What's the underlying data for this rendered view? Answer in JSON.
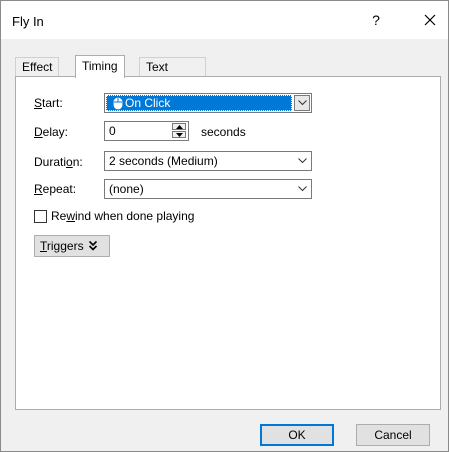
{
  "window": {
    "title": "Fly In",
    "help_label": "?",
    "close_label": "✕"
  },
  "tabs": [
    {
      "label": "Effect",
      "active": false
    },
    {
      "label": "Timing",
      "active": true
    },
    {
      "label": "Text Animation",
      "active": false
    }
  ],
  "timing": {
    "start": {
      "label_u": "S",
      "label_rest": "tart:",
      "value": "On Click",
      "icon": "mouse-icon"
    },
    "delay": {
      "label_u": "D",
      "label_rest": "elay:",
      "value": "0",
      "unit": "seconds"
    },
    "duration": {
      "label_pre": "Durati",
      "label_u": "o",
      "label_rest": "n:",
      "value": "2 seconds (Medium)"
    },
    "repeat": {
      "label_u": "R",
      "label_rest": "epeat:",
      "value": "(none)"
    },
    "rewind": {
      "label_pre": "Re",
      "label_u": "w",
      "label_rest": "ind when done playing",
      "checked": false
    },
    "triggers": {
      "label_u": "T",
      "label_rest": "riggers",
      "icon": "double-chevron-down-icon"
    }
  },
  "footer": {
    "ok_label": "OK",
    "cancel_label": "Cancel"
  },
  "colors": {
    "accent": "#0078d7",
    "dialog_bg": "#f0f0f0",
    "panel_bg": "#ffffff"
  }
}
